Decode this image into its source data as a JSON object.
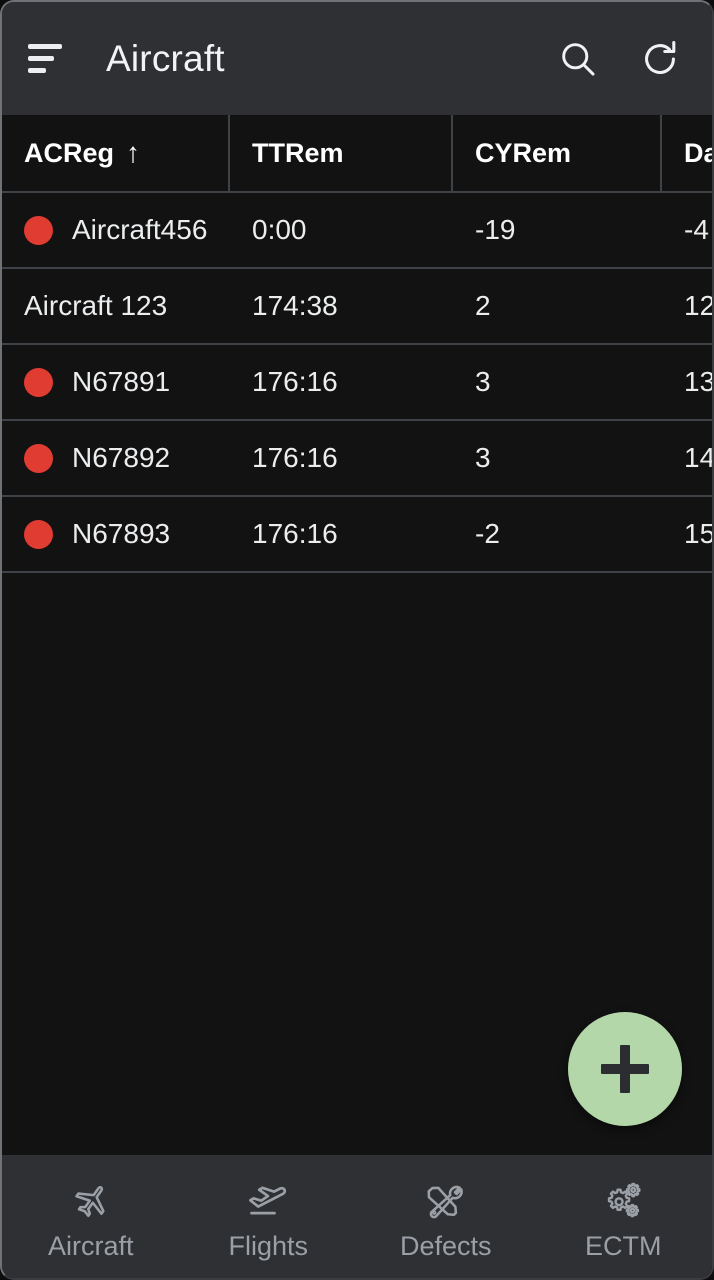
{
  "app": {
    "title": "Aircraft",
    "accent_color": "#b3d7a8",
    "status_color": "#e03c32",
    "appbar_color": "#2e3034",
    "background_color": "#121212"
  },
  "appbar": {
    "menu_icon": "menu-icon",
    "search_icon": "search-icon",
    "refresh_icon": "refresh-icon"
  },
  "table": {
    "columns": [
      {
        "label": "ACReg",
        "sorted": true,
        "sort_arrow": "↑"
      },
      {
        "label": "TTRem",
        "sorted": false,
        "sort_arrow": ""
      },
      {
        "label": "CYRem",
        "sorted": false,
        "sort_arrow": ""
      },
      {
        "label": "Da",
        "sorted": false,
        "sort_arrow": ""
      }
    ],
    "rows": [
      {
        "status": "red",
        "acreg": "Aircraft456",
        "ttrem": "0:00",
        "cyrem": "-19",
        "darem": "-4"
      },
      {
        "status": "none",
        "acreg": "Aircraft 123",
        "ttrem": "174:38",
        "cyrem": "2",
        "darem": "12"
      },
      {
        "status": "red",
        "acreg": "N67891",
        "ttrem": "176:16",
        "cyrem": "3",
        "darem": "13"
      },
      {
        "status": "red",
        "acreg": "N67892",
        "ttrem": "176:16",
        "cyrem": "3",
        "darem": "14"
      },
      {
        "status": "red",
        "acreg": "N67893",
        "ttrem": "176:16",
        "cyrem": "-2",
        "darem": "15"
      }
    ]
  },
  "fab": {
    "icon": "plus-icon",
    "label": "Add"
  },
  "bottom_nav": {
    "items": [
      {
        "label": "Aircraft",
        "icon": "airplane-top-icon"
      },
      {
        "label": "Flights",
        "icon": "airplane-takeoff-icon"
      },
      {
        "label": "Defects",
        "icon": "tools-icon"
      },
      {
        "label": "ECTM",
        "icon": "gears-icon"
      }
    ]
  }
}
